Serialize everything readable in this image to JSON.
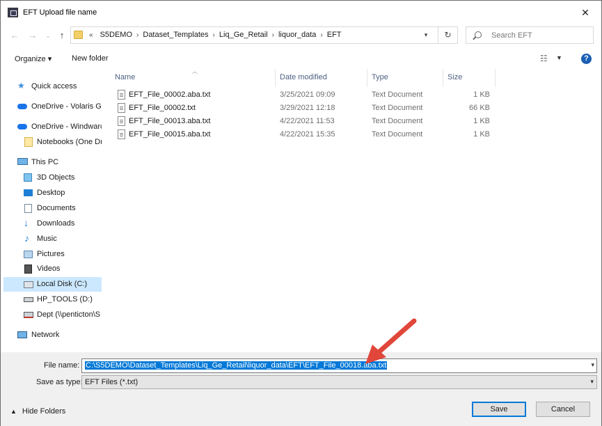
{
  "window": {
    "title": "EFT Upload file name",
    "close_glyph": "✕"
  },
  "address_bar": {
    "overflow": "«",
    "crumbs": [
      "S5DEMO",
      "Dataset_Templates",
      "Liq_Ge_Retail",
      "liquor_data",
      "EFT"
    ]
  },
  "search": {
    "placeholder": "Search EFT"
  },
  "toolbar": {
    "organize_label": "Organize ▾",
    "new_folder_label": "New folder"
  },
  "sidebar": {
    "items": [
      {
        "label": "Quick access",
        "icon": "star-icon"
      },
      {
        "label": "OneDrive - Volaris Gro",
        "icon": "cloud-icon"
      },
      {
        "label": "OneDrive - Windwarc",
        "icon": "cloud-icon"
      },
      {
        "label": "Notebooks (One Dr",
        "icon": "folder-icon"
      },
      {
        "label": "This PC",
        "icon": "computer-icon"
      },
      {
        "label": "3D Objects",
        "icon": "cube-icon"
      },
      {
        "label": "Desktop",
        "icon": "desktop-icon"
      },
      {
        "label": "Documents",
        "icon": "documents-icon"
      },
      {
        "label": "Downloads",
        "icon": "download-icon"
      },
      {
        "label": "Music",
        "icon": "music-icon"
      },
      {
        "label": "Pictures",
        "icon": "pictures-icon"
      },
      {
        "label": "Videos",
        "icon": "videos-icon"
      },
      {
        "label": "Local Disk (C:)",
        "icon": "disk-icon"
      },
      {
        "label": "HP_TOOLS (D:)",
        "icon": "drive-icon"
      },
      {
        "label": "Dept (\\\\penticton\\S",
        "icon": "network-drive-icon"
      },
      {
        "label": "Network",
        "icon": "network-icon"
      }
    ]
  },
  "file_list": {
    "columns": [
      "Name",
      "Date modified",
      "Type",
      "Size"
    ],
    "rows": [
      {
        "name": "EFT_File_00002.aba.txt",
        "date": "3/25/2021 09:09",
        "type": "Text Document",
        "size": "1 KB"
      },
      {
        "name": "EFT_File_00002.txt",
        "date": "3/29/2021 12:18",
        "type": "Text Document",
        "size": "66 KB"
      },
      {
        "name": "EFT_File_00013.aba.txt",
        "date": "4/22/2021 11:53",
        "type": "Text Document",
        "size": "1 KB"
      },
      {
        "name": "EFT_File_00015.aba.txt",
        "date": "4/22/2021 15:35",
        "type": "Text Document",
        "size": "1 KB"
      }
    ]
  },
  "form": {
    "file_name_label": "File name:",
    "file_name_value": "C:\\S5DEMO\\Dataset_Templates\\Liq_Ge_Retail\\liquor_data\\EFT\\EFT_File_00018.aba.txt",
    "save_type_label": "Save as type:",
    "save_type_value": "EFT Files (*.txt)"
  },
  "footer": {
    "hide_folders_label": "Hide Folders",
    "save_label": "Save",
    "cancel_label": "Cancel"
  },
  "colors": {
    "selection": "#0078d7",
    "annotation_arrow": "#e0463a",
    "sidebar_selected": "#cce8ff"
  }
}
